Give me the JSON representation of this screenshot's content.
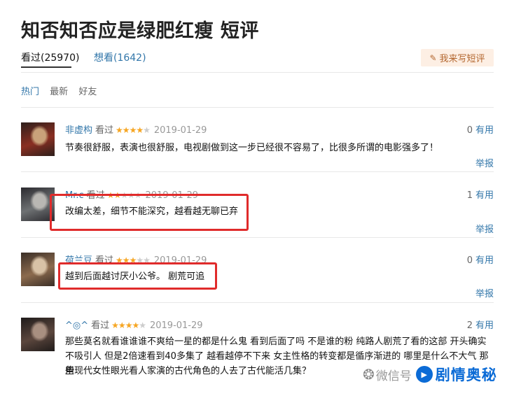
{
  "page": {
    "title": "知否知否应是绿肥红瘦 短评"
  },
  "tabs": {
    "watched": "看过(25970)",
    "want": "想看(1642)",
    "write_button": "我来写短评"
  },
  "sort": {
    "hot": "热门",
    "latest": "最新",
    "friends": "好友"
  },
  "labels": {
    "watched": "看过",
    "useful": "有用",
    "report": "举报"
  },
  "comments": [
    {
      "user": "非虚构",
      "rating": 4,
      "date": "2019-01-29",
      "useful_count": "0",
      "text": "节奏很舒服，表演也很舒服，电视剧做到这一步已经很不容易了，比很多所谓的电影强多了！",
      "avatar_colors": [
        "#2d1f1b",
        "#8a2f22",
        "#c9a27a"
      ]
    },
    {
      "user": "Mr.c",
      "rating": 2,
      "date": "2019-01-29",
      "useful_count": "1",
      "text": "改编太差，细节不能深究，越看越无聊已弃",
      "avatar_colors": [
        "#2b2a2f",
        "#6e7173",
        "#b9b7b3"
      ]
    },
    {
      "user": "荷兰豆",
      "rating": 3,
      "date": "2019-01-29",
      "useful_count": "0",
      "text": "越到后面越讨厌小公爷。 剧荒可追",
      "avatar_colors": [
        "#3a2e26",
        "#8c6b4e",
        "#d8c2a6"
      ]
    },
    {
      "user": "^◎^",
      "rating": 4,
      "date": "2019-01-29",
      "useful_count": "2",
      "text_lines": [
        "那些莫名就看谁谁谁不爽给一星的都是什么鬼 看到后面了吗 不是谁的粉 纯路人剧荒了看的这部 开头确实",
        "不吸引人 但是2倍速看到40多集了 越看越停不下来 女主性格的转变都是循序渐进的 哪里是什么不大气 那些",
        "用现代女性眼光看人家演的古代角色的人去了古代能活几集？"
      ],
      "avatar_colors": [
        "#1f1b1a",
        "#5b463d",
        "#a88f80"
      ]
    }
  ],
  "watermark": {
    "left": "微信号",
    "right": "剧情奥秘"
  },
  "colors": {
    "link": "#3377aa",
    "star": "#f6a623",
    "highlight": "#e02b2b",
    "brand": "#0b6bd6"
  }
}
